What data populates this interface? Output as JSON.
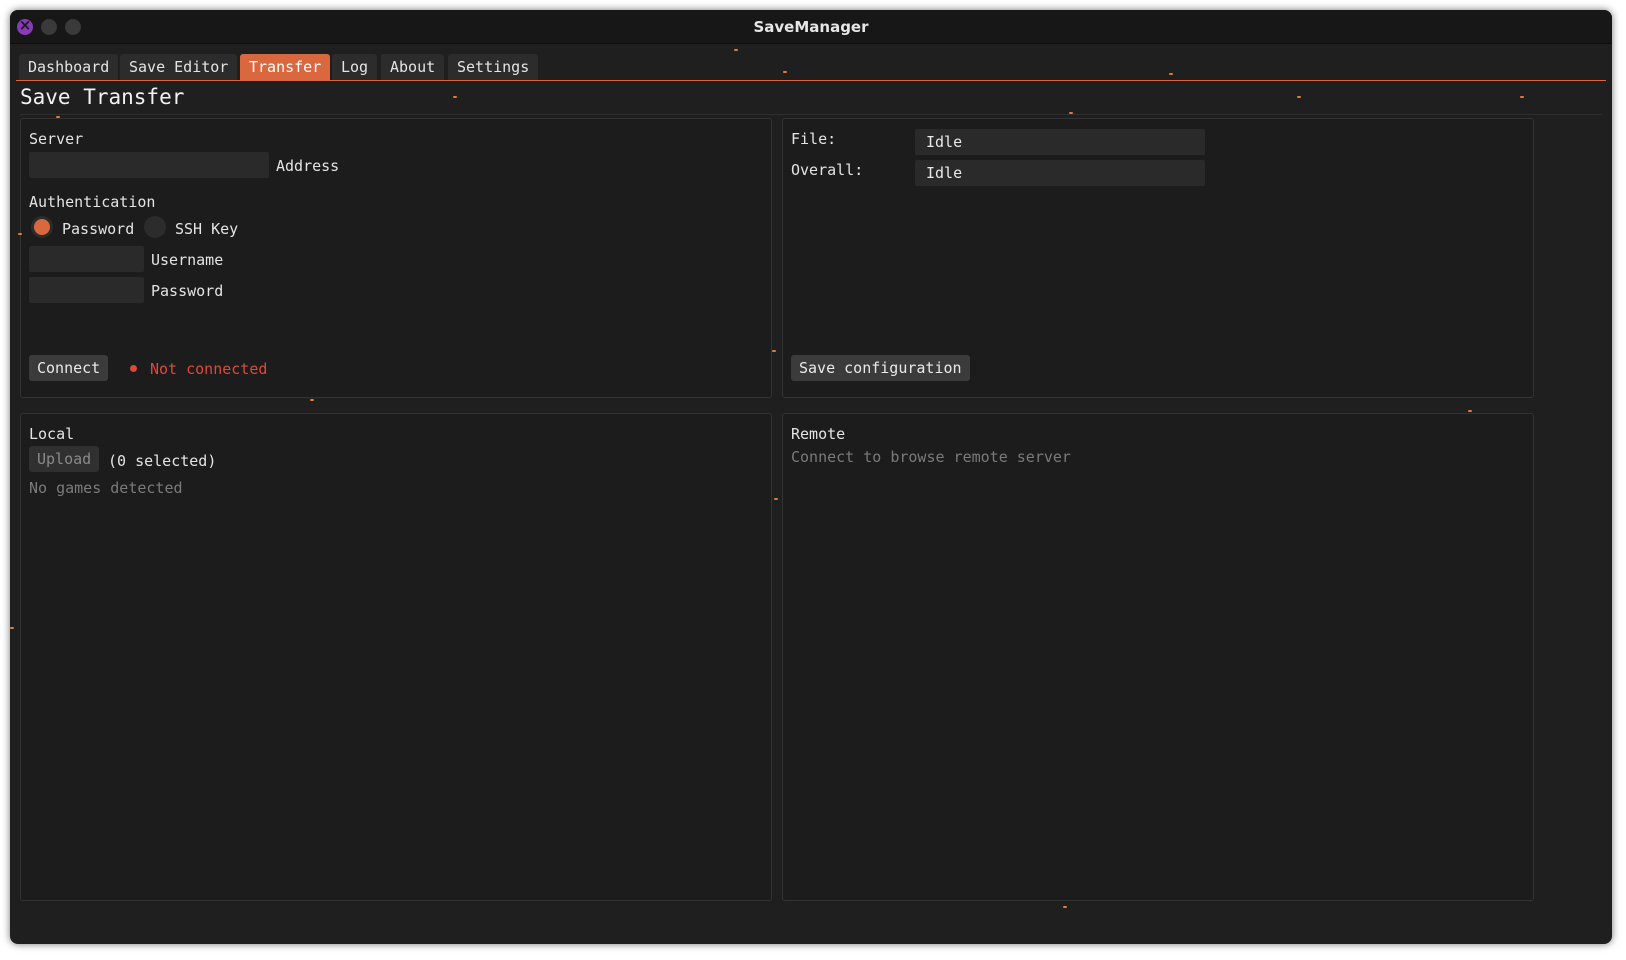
{
  "window": {
    "title": "SaveManager"
  },
  "tabs": [
    {
      "label": "Dashboard",
      "active": false
    },
    {
      "label": "Save Editor",
      "active": false
    },
    {
      "label": "Transfer",
      "active": true
    },
    {
      "label": "Log",
      "active": false
    },
    {
      "label": "About",
      "active": false
    },
    {
      "label": "Settings",
      "active": false
    }
  ],
  "page": {
    "title": "Save Transfer"
  },
  "server": {
    "section_label": "Server",
    "address_label": "Address",
    "address_value": "",
    "auth_label": "Authentication",
    "auth_options": [
      {
        "label": "Password",
        "selected": true
      },
      {
        "label": "SSH Key",
        "selected": false
      }
    ],
    "username_label": "Username",
    "username_value": "",
    "password_label": "Password",
    "password_value": "",
    "connect_label": "Connect",
    "status_text": "Not connected"
  },
  "progress": {
    "file_label": "File:",
    "file_status": "Idle",
    "overall_label": "Overall:",
    "overall_status": "Idle",
    "save_config_label": "Save configuration"
  },
  "local": {
    "section_label": "Local",
    "upload_label": "Upload",
    "selected_text": "(0 selected)",
    "empty_text": "No games detected"
  },
  "remote": {
    "section_label": "Remote",
    "empty_text": "Connect to browse remote server"
  },
  "colors": {
    "accent": "#d9683f",
    "error": "#e0473c",
    "background": "#1f1f1f",
    "panel": "#1c1c1c",
    "close_button": "#8a3ab9"
  }
}
